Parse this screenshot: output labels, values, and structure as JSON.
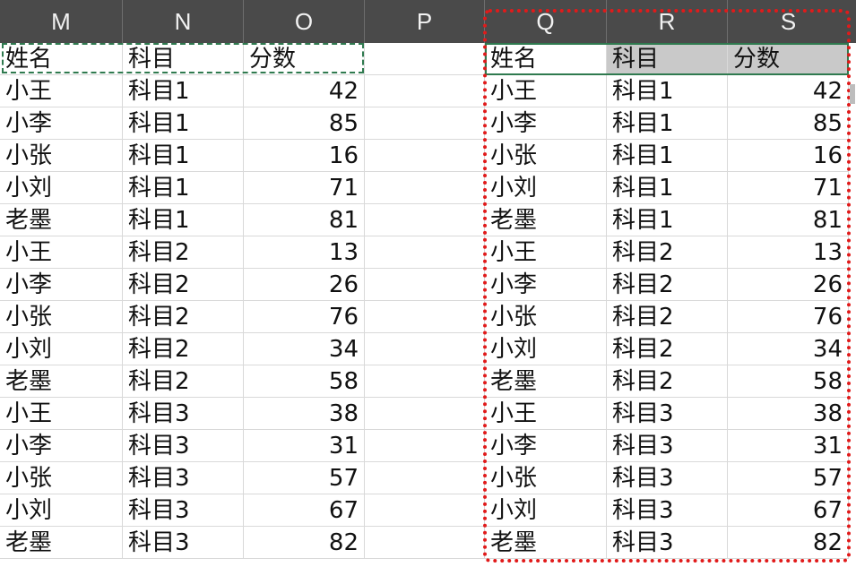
{
  "columns": [
    "M",
    "N",
    "O",
    "P",
    "Q",
    "R",
    "S"
  ],
  "left_table": {
    "header": [
      "姓名",
      "科目",
      "分数"
    ],
    "rows": [
      [
        "小王",
        "科目1",
        "42"
      ],
      [
        "小李",
        "科目1",
        "85"
      ],
      [
        "小张",
        "科目1",
        "16"
      ],
      [
        "小刘",
        "科目1",
        "71"
      ],
      [
        "老墨",
        "科目1",
        "81"
      ],
      [
        "小王",
        "科目2",
        "13"
      ],
      [
        "小李",
        "科目2",
        "26"
      ],
      [
        "小张",
        "科目2",
        "76"
      ],
      [
        "小刘",
        "科目2",
        "34"
      ],
      [
        "老墨",
        "科目2",
        "58"
      ],
      [
        "小王",
        "科目3",
        "38"
      ],
      [
        "小李",
        "科目3",
        "31"
      ],
      [
        "小张",
        "科目3",
        "57"
      ],
      [
        "小刘",
        "科目3",
        "67"
      ],
      [
        "老墨",
        "科目3",
        "82"
      ]
    ]
  },
  "right_table": {
    "header": [
      "姓名",
      "科目",
      "分数"
    ],
    "rows": [
      [
        "小王",
        "科目1",
        "42"
      ],
      [
        "小李",
        "科目1",
        "85"
      ],
      [
        "小张",
        "科目1",
        "16"
      ],
      [
        "小刘",
        "科目1",
        "71"
      ],
      [
        "老墨",
        "科目1",
        "81"
      ],
      [
        "小王",
        "科目2",
        "13"
      ],
      [
        "小李",
        "科目2",
        "26"
      ],
      [
        "小张",
        "科目2",
        "76"
      ],
      [
        "小刘",
        "科目2",
        "34"
      ],
      [
        "老墨",
        "科目2",
        "58"
      ],
      [
        "小王",
        "科目3",
        "38"
      ],
      [
        "小李",
        "科目3",
        "31"
      ],
      [
        "小张",
        "科目3",
        "57"
      ],
      [
        "小刘",
        "科目3",
        "67"
      ],
      [
        "老墨",
        "科目3",
        "82"
      ]
    ]
  },
  "colors": {
    "header_bg": "#4a4a4a",
    "header_text": "#f2f2f2",
    "gridline": "#d9d9d9",
    "selection_green": "#2f7a4f",
    "selected_header_fill": "#c9c9c9",
    "annotation_red": "#e11a1a"
  }
}
